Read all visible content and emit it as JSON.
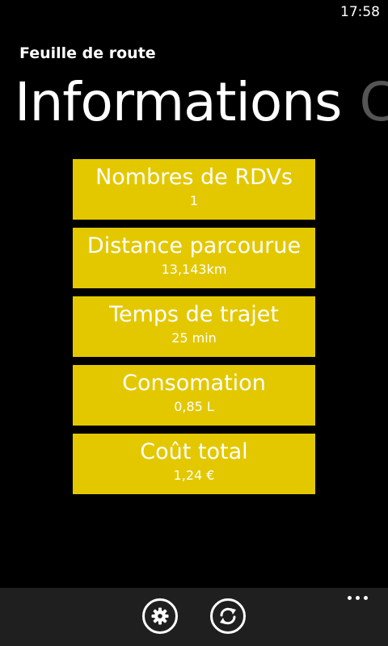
{
  "status_bar": {
    "time": "17:58"
  },
  "app": {
    "title": "Feuille de route"
  },
  "pivot": {
    "active_label": "Informations",
    "next_label": "C"
  },
  "tiles": [
    {
      "title": "Nombres de RDVs",
      "value": "1"
    },
    {
      "title": "Distance parcourue",
      "value": "13,143km"
    },
    {
      "title": "Temps de trajet",
      "value": "25 min"
    },
    {
      "title": "Consomation",
      "value": "0,85 L"
    },
    {
      "title": "Coût total",
      "value": "1,24 €"
    }
  ],
  "app_bar": {
    "buttons": [
      {
        "icon": "gear-icon"
      },
      {
        "icon": "refresh-icon"
      }
    ],
    "more_icon": "more-dots-icon"
  },
  "colors": {
    "background": "#000000",
    "tile": "#e3c800",
    "app_bar": "#1f1f1f",
    "pivot_inactive": "#555555"
  }
}
